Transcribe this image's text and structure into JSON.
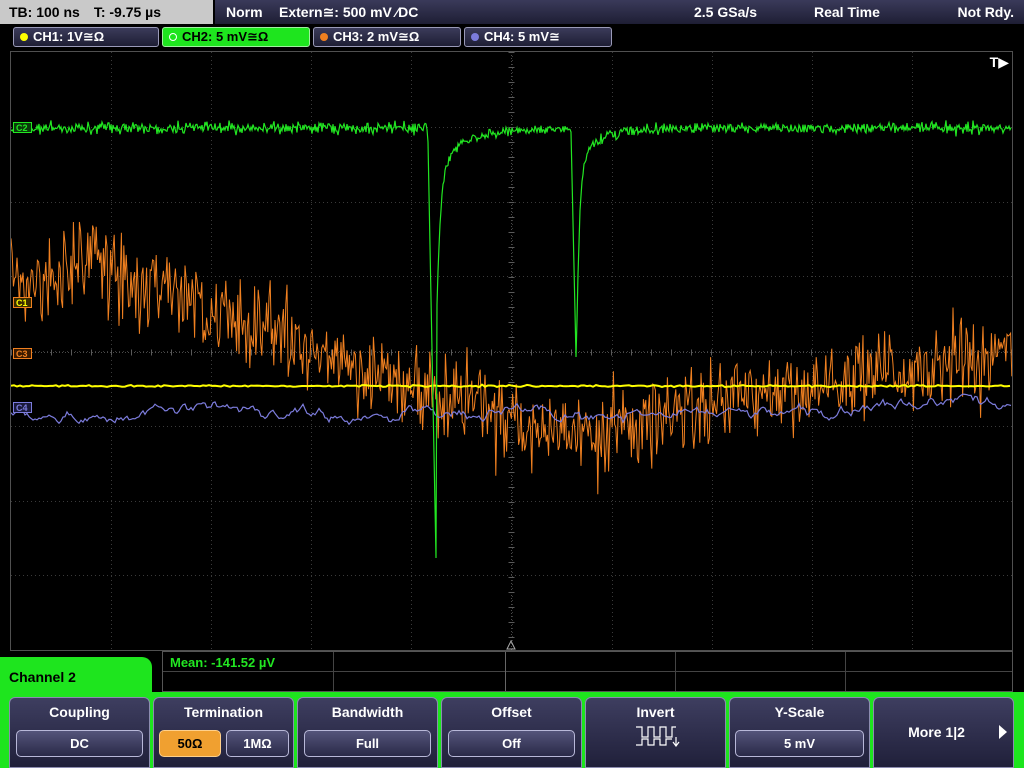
{
  "status": {
    "timebase": "TB: 100 ns",
    "trigger_time": "T: -9.75 µs",
    "mode": "Norm",
    "trigger_source": "Extern≅: 500 mV ⁄DC",
    "sample_rate": "2.5 GSa/s",
    "acquisition": "Real Time",
    "state": "Not Rdy."
  },
  "channels": [
    {
      "label": "CH1: 1V≅Ω",
      "color": "#ffff00"
    },
    {
      "label": "CH2: 5 mV≅Ω",
      "color": "#22e622"
    },
    {
      "label": "CH3: 2 mV≅Ω",
      "color": "#f08020"
    },
    {
      "label": "CH4: 5 mV≅",
      "color": "#7c7cdc"
    }
  ],
  "screen": {
    "trigger_marker": "T▶",
    "markers": {
      "c2": "C2",
      "c1": "C1",
      "c3": "C3",
      "c4": "C4"
    }
  },
  "measurement": {
    "text": "Mean: -141.52 µV"
  },
  "menu": {
    "title": "Channel 2",
    "coupling": {
      "title": "Coupling",
      "value": "DC"
    },
    "termination": {
      "title": "Termination",
      "options": [
        "50Ω",
        "1MΩ"
      ],
      "selected": "50Ω"
    },
    "bandwidth": {
      "title": "Bandwidth",
      "value": "Full"
    },
    "offset": {
      "title": "Offset",
      "value": "Off"
    },
    "invert": {
      "title": "Invert"
    },
    "yscale": {
      "title": "Y-Scale",
      "value": "5 mV"
    },
    "more": {
      "label": "More 1|2"
    }
  }
}
